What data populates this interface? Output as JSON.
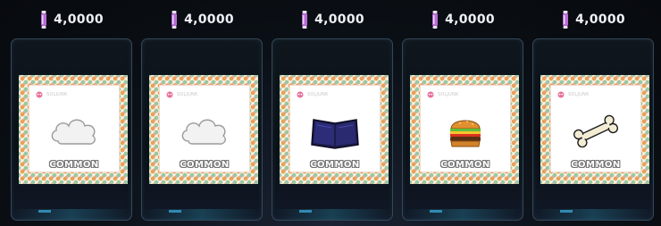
{
  "cards": [
    {
      "price": "4,0000",
      "brand": "SOLJUNK",
      "rarity": "COMMON",
      "item_icon": "cloud-icon"
    },
    {
      "price": "4,0000",
      "brand": "SOLJUNK",
      "rarity": "COMMON",
      "item_icon": "cloud-icon"
    },
    {
      "price": "4,0000",
      "brand": "SOLJUNK",
      "rarity": "COMMON",
      "item_icon": "book-icon"
    },
    {
      "price": "4,0000",
      "brand": "SOLJUNK",
      "rarity": "COMMON",
      "item_icon": "burger-icon"
    },
    {
      "price": "4,0000",
      "brand": "SOLJUNK",
      "rarity": "COMMON",
      "item_icon": "bone-icon"
    }
  ],
  "colors": {
    "currency_vial": "#b86bd6",
    "card_border": "#34485a",
    "rarity_text": "#ffffff"
  }
}
